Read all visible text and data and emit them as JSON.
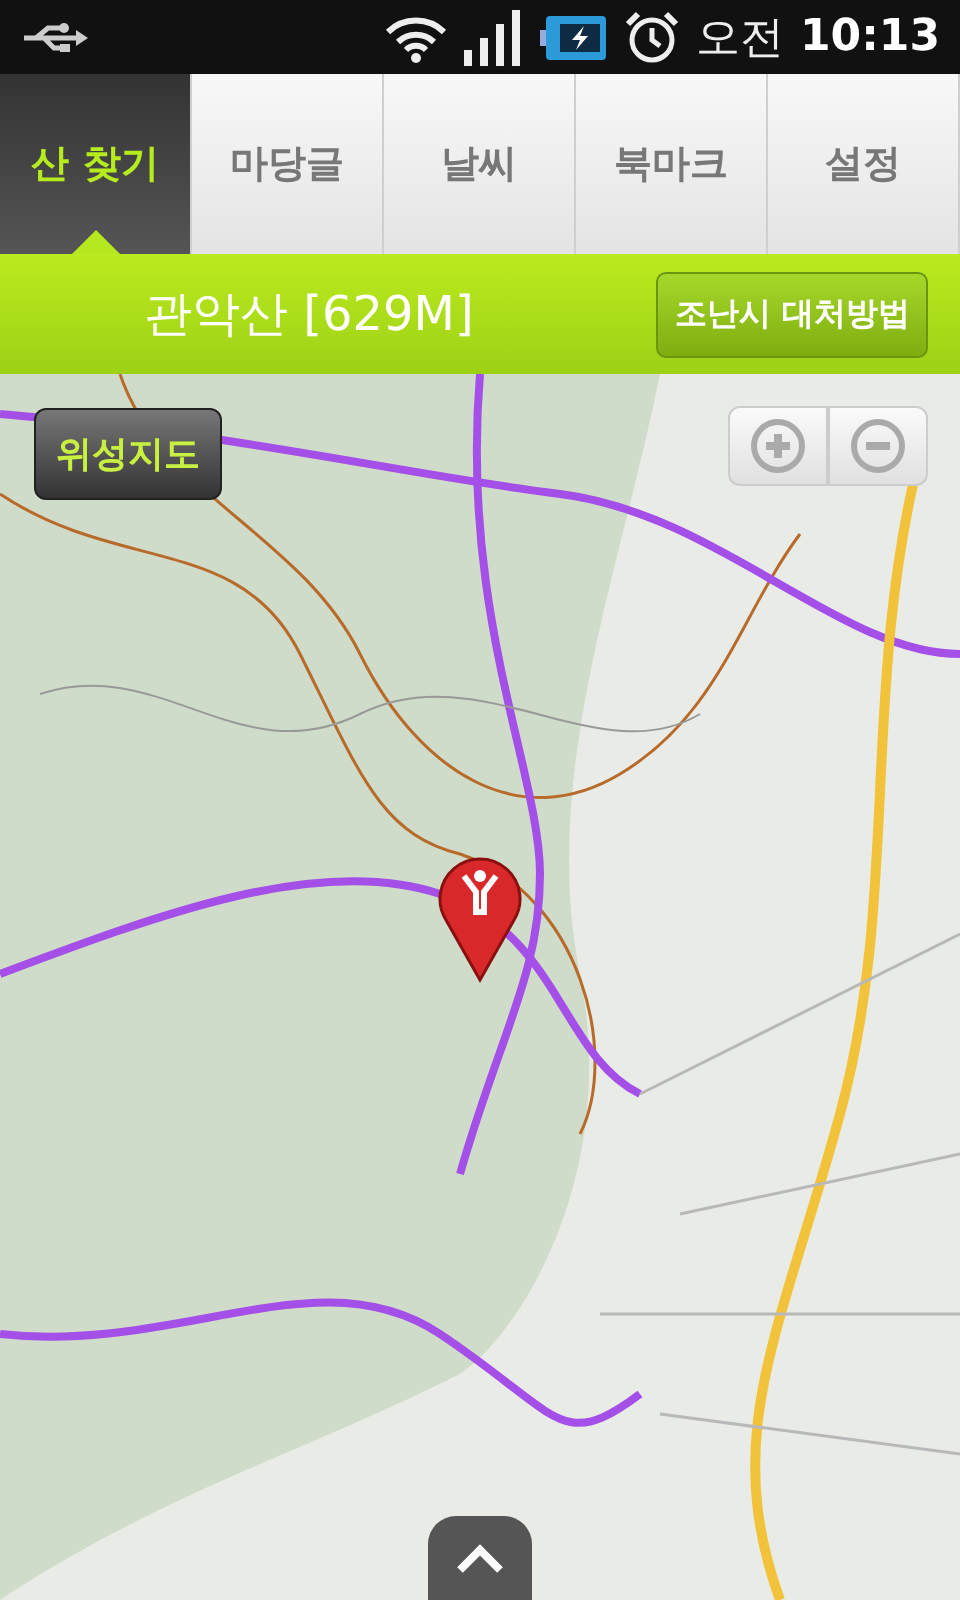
{
  "status_bar": {
    "period": "오전",
    "time": "10:13"
  },
  "tabs": [
    {
      "label": "산 찾기",
      "selected": true
    },
    {
      "label": "마당글",
      "selected": false
    },
    {
      "label": "날씨",
      "selected": false
    },
    {
      "label": "북마크",
      "selected": false
    },
    {
      "label": "설정",
      "selected": false
    }
  ],
  "header": {
    "title": "관악산 [629M]",
    "button": "조난시 대처방법"
  },
  "map": {
    "kind": "picture",
    "satellite_button": "위성지도"
  }
}
